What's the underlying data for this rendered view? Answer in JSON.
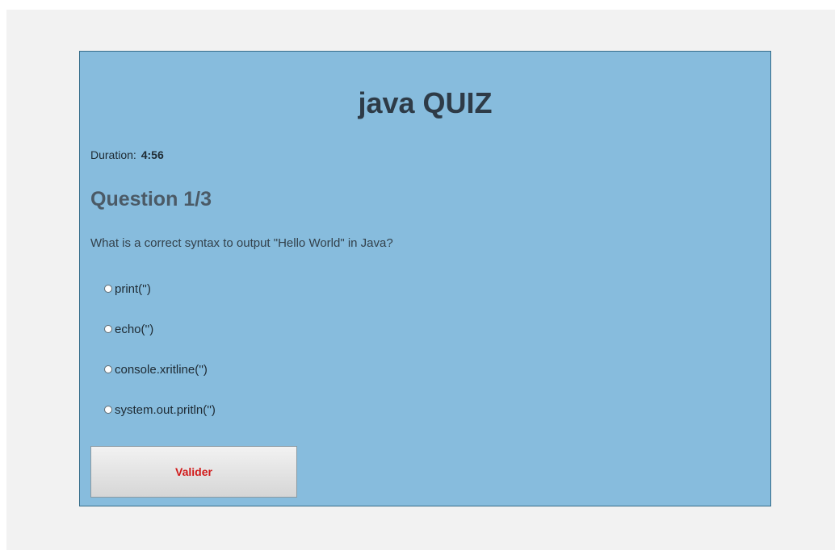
{
  "quiz": {
    "title": "java QUIZ",
    "duration_label": "Duration:",
    "duration_value": "4:56",
    "question_heading": "Question 1/3",
    "question_text": "What is a correct syntax to output \"Hello World\" in Java?",
    "options": [
      {
        "label": "print('')"
      },
      {
        "label": "echo('')"
      },
      {
        "label": "console.xritline('')"
      },
      {
        "label": "system.out.pritln('')"
      }
    ],
    "submit_label": "Valider"
  },
  "colors": {
    "card_background": "#87bcdd",
    "submit_text": "#d11a1a"
  }
}
